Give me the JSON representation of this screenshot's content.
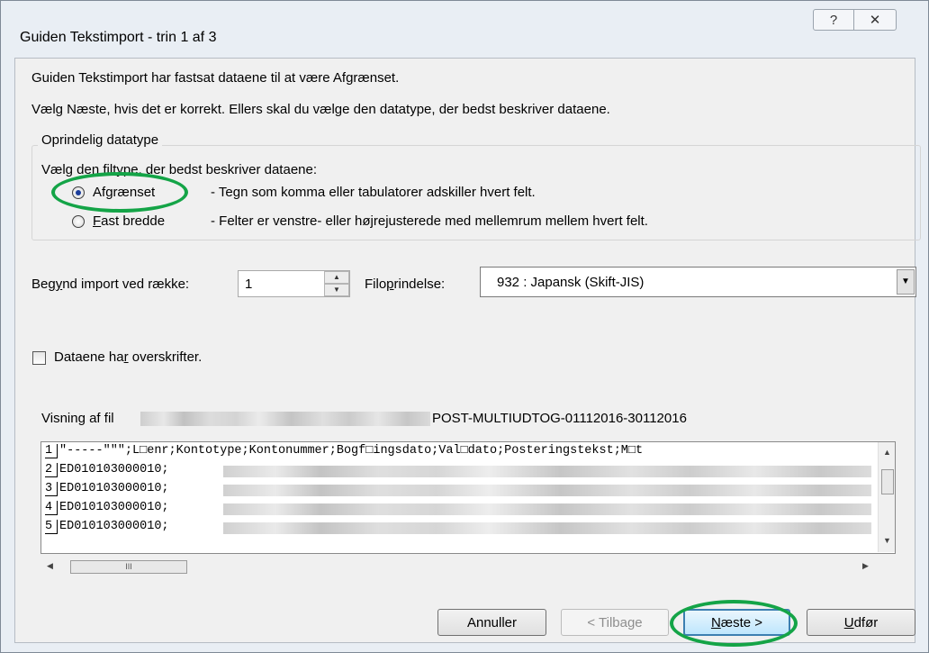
{
  "window": {
    "title": "Guiden Tekstimport - trin 1 af 3",
    "help_glyph": "?",
    "close_glyph": "✕"
  },
  "intro": {
    "line1": "Guiden Tekstimport har fastsat dataene til at være Afgrænset.",
    "line2": "Vælg Næste, hvis det er korrekt. Ellers skal du vælge den datatype, der bedst beskriver dataene."
  },
  "original_datatype": {
    "group_title": "Oprindelig datatype",
    "prompt": "Vælg den filtype, der bedst beskriver dataene:",
    "options": [
      {
        "label": "Afgrænset",
        "hotkey": "g",
        "description": "- Tegn som komma eller tabulatorer adskiller hvert felt.",
        "selected": true
      },
      {
        "label": "Fast bredde",
        "hotkey": "F",
        "description": "- Felter er venstre- eller højrejusterede med mellemrum mellem hvert felt.",
        "selected": false
      }
    ]
  },
  "start_row": {
    "label": "Begynd import ved række:",
    "value": "1"
  },
  "file_origin": {
    "label": "Filoprindelse:",
    "value": "932 : Japansk (Skift-JIS)"
  },
  "headers_checkbox": {
    "label": "Dataene har overskrifter.",
    "checked": false
  },
  "preview": {
    "label_prefix": "Visning af fil",
    "file_suffix": "POST-MULTIUDTOG-01112016-30112016",
    "rows": [
      {
        "num": "1",
        "text": "\"-----\"\"\";L□enr;Kontotype;Kontonummer;Bogf□ingsdato;Val□dato;Posteringstekst;M□t"
      },
      {
        "num": "2",
        "text": "ED010103000010;"
      },
      {
        "num": "3",
        "text": "ED010103000010;"
      },
      {
        "num": "4",
        "text": "ED010103000010;"
      },
      {
        "num": "5",
        "text": "ED010103000010;"
      }
    ],
    "scroll_thumb_glyph": "III"
  },
  "buttons": {
    "cancel": "Annuller",
    "back": "< Tilbage",
    "next": "Næste >",
    "finish": "Udfør"
  },
  "colors": {
    "annotation": "#14a447",
    "radio_dot": "#1b3d9b",
    "default_button_border": "#3c7fb1"
  }
}
